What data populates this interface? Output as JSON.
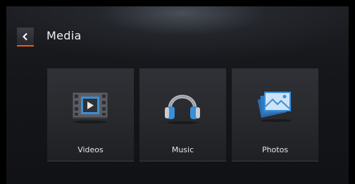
{
  "header": {
    "title": "Media",
    "back_icon": "chevron-left-icon"
  },
  "tiles": [
    {
      "label": "Videos",
      "icon": "video-film-icon"
    },
    {
      "label": "Music",
      "icon": "headphones-icon"
    },
    {
      "label": "Photos",
      "icon": "photos-icon"
    }
  ],
  "colors": {
    "accent": "#f05a13",
    "icon_blue": "#3a8fd6",
    "text": "#f1f1f1"
  }
}
